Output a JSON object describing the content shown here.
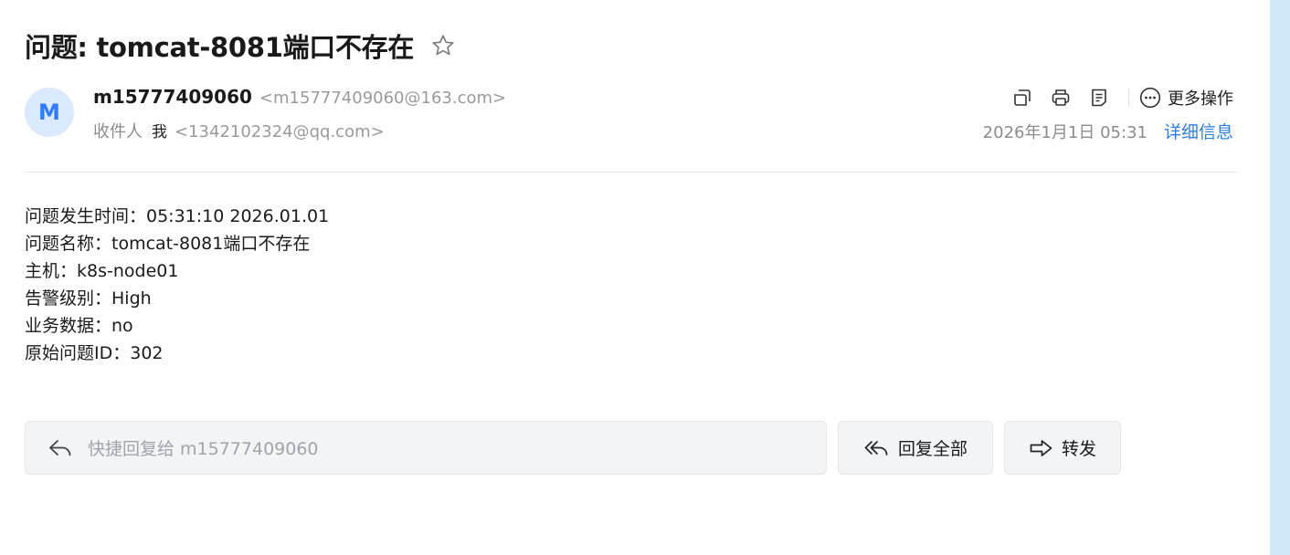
{
  "email": {
    "subject": "问题: tomcat-8081端口不存在",
    "sender": {
      "avatar_letter": "M",
      "name": "m15777409060",
      "address": "<m15777409060@163.com>"
    },
    "recipient": {
      "label": "收件人",
      "name": "我",
      "address": "<1342102324@qq.com>"
    },
    "date": "2026年1月1日 05:31",
    "detail_link": "详细信息",
    "body_lines": [
      "问题发生时间：05:31:10 2026.01.01",
      "问题名称：tomcat-8081端口不存在",
      "主机：k8s-node01",
      "告警级别：High",
      "业务数据：no",
      "原始问题ID：302"
    ]
  },
  "toolbar": {
    "icons": [
      "open-new-window-icon",
      "print-icon",
      "note-icon",
      "more-dots-icon"
    ],
    "more_label": "更多操作"
  },
  "actions": {
    "quick_reply_placeholder": "快捷回复给 m15777409060",
    "reply_all_label": "回复全部",
    "forward_label": "转发"
  },
  "colors": {
    "accent_link": "#2f7fd8",
    "avatar_bg": "#dbe9ff",
    "avatar_fg": "#2f7bff",
    "side_strip": "#cfe9fb"
  }
}
